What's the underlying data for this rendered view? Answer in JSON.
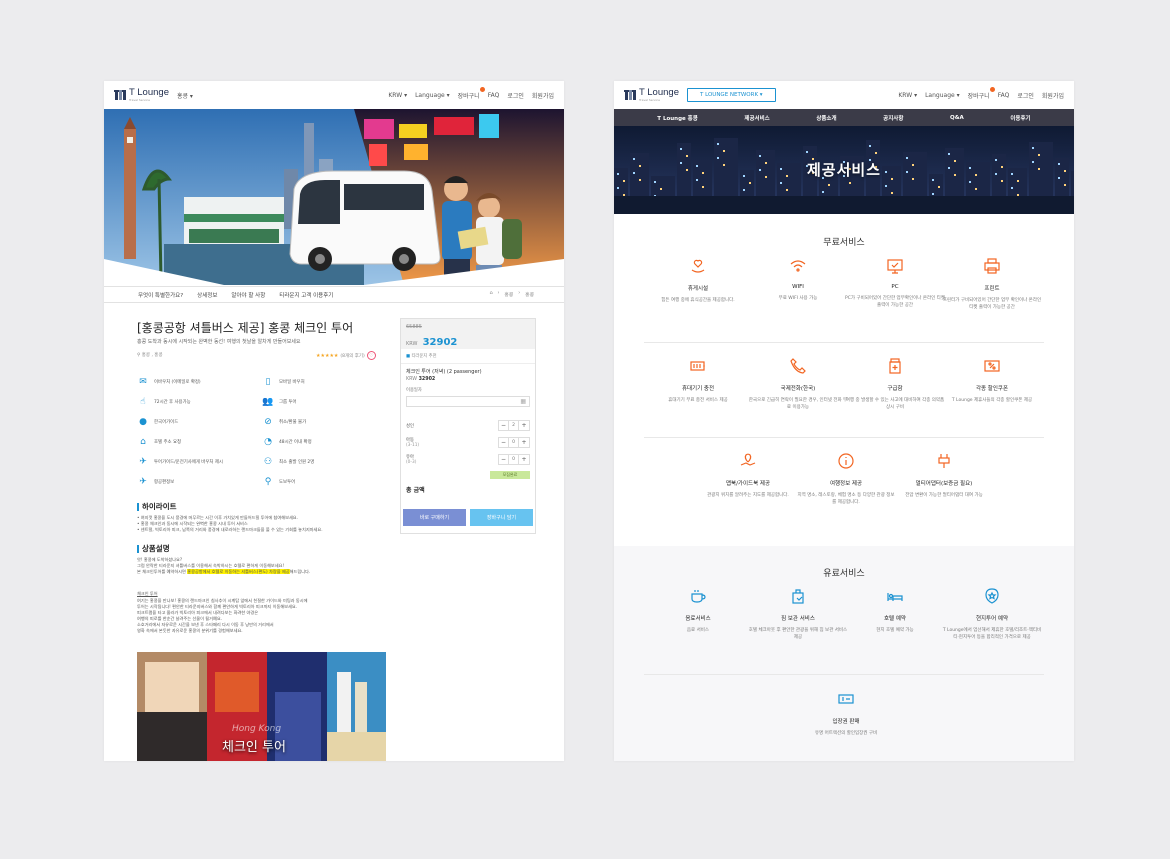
{
  "left": {
    "header": {
      "logo": "T Lounge",
      "logo_sub": "Travel Service",
      "region": "홍콩 ▾",
      "nav": [
        "KRW ▾",
        "Language ▾",
        "장바구니",
        "FAQ",
        "로그인",
        "회원가입"
      ]
    },
    "subnav": [
      "무엇이 특별한가요?",
      "상세정보",
      "알아야 할 사항",
      "티라운지 고객 이용후기"
    ],
    "breadcrumb": [
      "⌂",
      "›",
      "홍콩",
      "›",
      "홍콩"
    ],
    "product": {
      "title": "[홍콩공항 셔틀버스 제공] 홍콩 체크인 투어",
      "subtitle": "홍콩 도착과 동시에 시작되는 완벽한 동선! 여행의 첫날을 알차게 만들어보세요",
      "location": "홍콩 , 홍콩",
      "rating": "★★★★★",
      "reviews": "(8개의 후기)"
    },
    "features": [
      {
        "icon": "ticket-icon",
        "label": "이바우처 (이메일로 확정)"
      },
      {
        "icon": "mobile-icon",
        "label": "모바일 바우처"
      },
      {
        "icon": "hand-icon",
        "label": "72시간 후 사용가능"
      },
      {
        "icon": "group-icon",
        "label": "그룹 투어"
      },
      {
        "icon": "korean-guide-icon",
        "label": "한국어가이드"
      },
      {
        "icon": "no-cancel-icon",
        "label": "취소/환불 불가"
      },
      {
        "icon": "home-icon",
        "label": "호텔 주소 요청"
      },
      {
        "icon": "48h-icon",
        "label": "48시간 이내 확정"
      },
      {
        "icon": "compass-icon",
        "label": "투어가이드/운전기사에게 바우처 제시"
      },
      {
        "icon": "people-icon",
        "label": "최소 출발 인원 2명"
      },
      {
        "icon": "plane-icon",
        "label": "항공편정보"
      },
      {
        "icon": "walk-icon",
        "label": "도보투어"
      }
    ],
    "highlights": {
      "title": "하이라이트",
      "lines": "• 여지껏 홍콩을 도시 풍경에 머무르는 시간 이후 가치있게 만들어드릴 투어에 참여해보세요.\n• 홍콩 체크인과 동시에 시작되는 완벽한 홍콩 시내 투어 서비스\n• 센트럴, 빅토리아 피크, 남쪽의 거리와 풍경에 내로라하는 랜드마크들을 볼 수 있는 기회를 놓치지마세요."
    },
    "desc": {
      "title": "상품설명",
      "line1": "앗! 홍콩에 도착하셨나요?",
      "line2": "그럼 안락한 티라운지 셔틀버스를 이용해서 숙박하시는 호텔로 편하게 이동해보세요!",
      "line3a": "본 체크인투어를 예약하시면 ",
      "line3hl": "홍콩공항에서 호텔로 이동하는 셔틀버스(편도) 차량을 제공",
      "line3b": "해드립니다.",
      "sub_title": "체크인 투어",
      "sub_body": "여기는 홍콩을 만나보! 홍콩의 랜드마크인 침사추이 시계탑 앞에서 친절한 가이드와 미팅과 동시에\n투어는 시작됩니다! 편안한 티라운지버스와 함께 편안하게 빅토리아 피크까지 이동해보세요.\n피크트램을 타고 올라가 빅토리아 피크에서 내려다보는 화려한 야경은\n여행의 피로를 한순간 날려주는 선물이 될거예요.\n소호거리에서 자유로운 시간을 보낸 후 스타페리 다시 이동 후 낭만의 거리에서\n영화 속에서 본듯한 자유로운 홍콩의 분위기를 경험해보세요."
    },
    "photo": {
      "caption": "체크인 투어",
      "overlay": "Hong Kong"
    },
    "booking": {
      "old_price": "65885",
      "currency": "KRW",
      "price": "32902",
      "note": "티라운지 추천",
      "item": "체크인 투어 (저녁) (2 passenger)",
      "item_currency": "KRW",
      "item_price": "32902",
      "date_label": "이용일자",
      "adult": "성인",
      "adult_val": "2",
      "child": "아동",
      "child_sub": "(3-11)",
      "child_val": "0",
      "infant": "유아",
      "infant_sub": "(0-3)",
      "infant_val": "0",
      "apply": "모집완료",
      "total": "총 금액",
      "buy": "바로 구매하기",
      "cart": "장바구니 담기"
    }
  },
  "right": {
    "header": {
      "logo": "T Lounge",
      "logo_sub": "Travel Service",
      "network": "T LOUNGE NETWORK",
      "nav": [
        "KRW ▾",
        "Language ▾",
        "장바구니",
        "FAQ",
        "로그인",
        "회원가입"
      ]
    },
    "topnav": [
      "T Lounge 홍콩",
      "제공서비스",
      "상품소개",
      "공지사항",
      "Q&A",
      "이용후기"
    ],
    "hero_title": "제공서비스",
    "free_title": "무료서비스",
    "free": [
      {
        "icon": "heart-hand-icon",
        "name": "휴게시설",
        "desc": "힘든 여행 중에 휴식공간을 제공합니다."
      },
      {
        "icon": "wifi-icon",
        "name": "WIFI",
        "desc": "무료 WIFI 사용 가능"
      },
      {
        "icon": "monitor-icon",
        "name": "PC",
        "desc": "PC가 구비되어있어 간단한 업무확인이나 온라인 티켓 출력이 가능한 공간"
      },
      {
        "icon": "printer-icon",
        "name": "프린트",
        "desc": "프린터가 구비되어있어 간단한 업무 확인이나 온라인 티켓 출력이 가능한 공간"
      },
      {
        "icon": "battery-icon",
        "name": "휴대기기 충전",
        "desc": "휴대기기 무료 충전 서비스 제공"
      },
      {
        "icon": "phone-icon",
        "name": "국제전화(한국)",
        "desc": "한국으로 긴급히 연락이 필요한 경우, 인터넷 전화 무료 이용가능"
      },
      {
        "icon": "medicine-icon",
        "name": "구급함",
        "desc": "여행 중 발생할 수 있는 사고에 대비하여 각종 의약품 상시 구비"
      },
      {
        "icon": "coupon-icon",
        "name": "각종 할인쿠폰",
        "desc": "T Lounge 제휴사들의 각종 할인쿠폰 제공"
      },
      {
        "icon": "map-icon",
        "name": "맵북/가이드북 제공",
        "desc": "관광지 위치를 알려주는 지도를 제공합니다."
      },
      {
        "icon": "info-icon",
        "name": "여행정보 제공",
        "desc": "지역 명소, 레스토랑, 체험 명소 등 다양한 관광 정보를 제공합니다."
      },
      {
        "icon": "plug-icon",
        "name": "멀티어댑터(보증금 필요)",
        "desc": "전압 변환이 가능한 멀티어댑터 대여 가능"
      }
    ],
    "paid_title": "유료서비스",
    "paid": [
      {
        "icon": "coffee-icon",
        "name": "음료서비스",
        "desc": "음료 서비스"
      },
      {
        "icon": "luggage-icon",
        "name": "짐 보관 서비스",
        "desc": "호텔 체크아웃 후 편안한 관광을 위해 짐 보관 서비스 제공"
      },
      {
        "icon": "bed-icon",
        "name": "호텔 예약",
        "desc": "현지 호텔 예약 가능"
      },
      {
        "icon": "badge-icon",
        "name": "현지투어 예약",
        "desc": "T Lounge에서 엄선해서 제휴한 호텔/리조트·액티비티·현지투어 등을 합리적인 가격으로 제공"
      },
      {
        "icon": "ticket-icon",
        "name": "입장권 판매",
        "desc": "유명 어트랙션의 할인입장권 구비"
      }
    ]
  },
  "colors": {
    "accent": "#1b92d1",
    "orange": "#f26522",
    "nav_dark": "#3b3b48",
    "buy": "#7a8fd4",
    "cart": "#67c3f0"
  }
}
